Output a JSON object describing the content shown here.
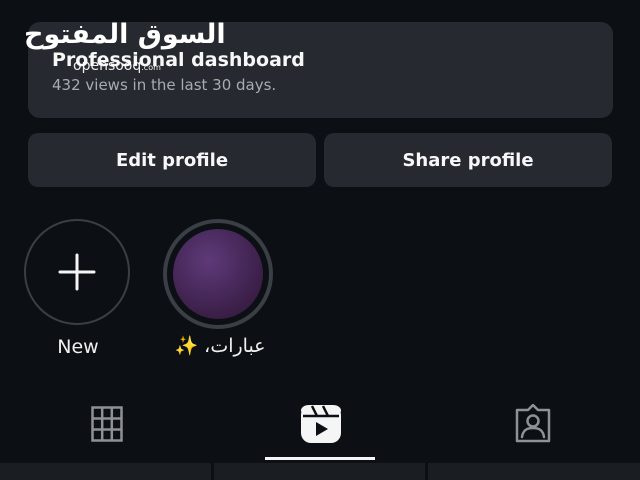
{
  "watermark": {
    "arabic": "السوق المفتوح",
    "latin": "opensooq",
    "suffix": ".com"
  },
  "dashboard": {
    "title": "Professional dashboard",
    "subtitle": "432 views in the last 30 days."
  },
  "actions": {
    "edit_label": "Edit profile",
    "share_label": "Share profile"
  },
  "highlights": {
    "new_label": "New",
    "story_label": "عبارات، ✨"
  },
  "tabs": [
    {
      "icon": "grid-icon",
      "active": false
    },
    {
      "icon": "reels-icon",
      "active": true
    },
    {
      "icon": "tagged-icon",
      "active": false
    }
  ],
  "colors": {
    "background": "#0c0f14",
    "card": "#262a30",
    "text": "#f5f5f5",
    "subtext": "#a8acb2",
    "ring": "#3a3e45"
  }
}
